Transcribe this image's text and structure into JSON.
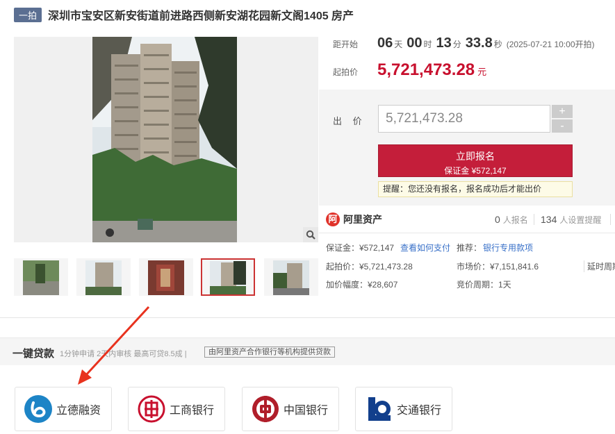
{
  "header": {
    "tag": "一拍",
    "title": "深圳市宝安区新安街道前进路西侧新安湖花园新文阁1405 房产"
  },
  "countdown": {
    "label": "距开始",
    "days": "06",
    "days_unit": "天",
    "hours": "00",
    "hours_unit": "时",
    "minutes": "13",
    "minutes_unit": "分",
    "seconds": "33.8",
    "seconds_unit": "秒",
    "start_note": "(2025-07-21 10:00开拍)"
  },
  "start_price": {
    "label": "起拍价",
    "value": "5,721,473.28",
    "unit": "元"
  },
  "bid": {
    "label": "出 价",
    "input_value": "5,721,473.28",
    "plus": "+",
    "minus": "-",
    "signup_label": "立即报名",
    "signup_deposit": "保证金 ¥572,147",
    "tip": "提醒：您还没有报名，报名成功后才能出价"
  },
  "platform": {
    "logo_glyph": "阿",
    "name": "阿里资产",
    "signups_count": "0",
    "signups_label": "人报名",
    "reminders_count": "134",
    "reminders_label": "人设置提醒"
  },
  "details": {
    "deposit": "保证金：¥572,147",
    "how_to_pay": "查看如何支付",
    "recommend_label": "推荐：",
    "recommend_link": "银行专用款项",
    "start_price": "起拍价：¥5,721,473.28",
    "market_price": "市场价：¥7,151,841.6",
    "extension": "延时周期",
    "increment": "加价幅度：¥28,607",
    "bid_cycle": "竞价周期：1天"
  },
  "loan": {
    "title": "一键贷款",
    "subtitle": "1分钟申请 2天内审核 最高可贷8.5成 |",
    "box": "由阿里资产合作银行等机构提供贷款"
  },
  "banks": [
    {
      "name": "立德融资"
    },
    {
      "name": "工商银行"
    },
    {
      "name": "中国银行"
    },
    {
      "name": "交通银行"
    }
  ],
  "colors": {
    "accent": "#c8102e",
    "link": "#3870c8",
    "tag": "#5b6f92",
    "arrow": "#e8321e"
  }
}
